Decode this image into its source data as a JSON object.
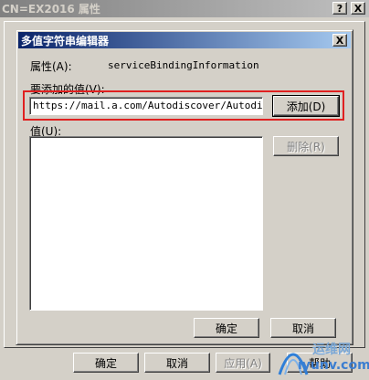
{
  "outer_window": {
    "title": "CN=EX2016 属性",
    "help_label": "?",
    "close_label": "X",
    "buttons": {
      "ok": "确定",
      "cancel": "取消",
      "apply": "应用(A)",
      "help": "帮助"
    }
  },
  "dialog": {
    "title": "多值字符串编辑器",
    "close_label": "X",
    "attribute_label": "属性(A):",
    "attribute_value": "serviceBindingInformation",
    "value_to_add_label": "要添加的值(V):",
    "value_to_add_input": "https://mail.a.com/Autodiscover/Autodisco",
    "add_button": "添加(D)",
    "values_label": "值(U):",
    "values_list": [],
    "remove_button": "删除(R)",
    "ok_button": "确定",
    "cancel_button": "取消"
  },
  "highlight_color": "#e02020",
  "watermark": {
    "line1": "运维网",
    "line2": "iyunv.com"
  }
}
